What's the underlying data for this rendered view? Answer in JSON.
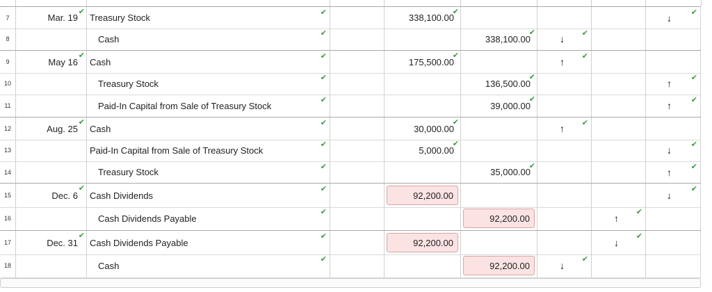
{
  "check_glyph": "✔",
  "arrow_up": "↑",
  "arrow_down": "↓",
  "colors": {
    "check": "#3d9a3d",
    "error_bg": "#fbe3e3",
    "error_border": "#d9a3a3"
  },
  "rows": [
    {
      "num": "7",
      "date": "Mar. 19",
      "account": "Treasury Stock",
      "indent": false,
      "debit": "338,100.00",
      "debit_check": true,
      "credit": "",
      "credit_check": false,
      "col1": "",
      "col2": "",
      "col3": "↓",
      "col3_check": true
    },
    {
      "num": "8",
      "date": "",
      "account": "Cash",
      "indent": true,
      "debit": "",
      "debit_check": false,
      "credit": "338,100.00",
      "credit_check": true,
      "col1": "↓",
      "col1_check": true,
      "col2": "",
      "col3": ""
    },
    {
      "num": "9",
      "date": "May 16",
      "account": "Cash",
      "indent": false,
      "debit": "175,500.00",
      "debit_check": true,
      "credit": "",
      "credit_check": false,
      "col1": "↑",
      "col1_check": true,
      "col2": "",
      "col3": ""
    },
    {
      "num": "10",
      "date": "",
      "account": "Treasury Stock",
      "indent": true,
      "debit": "",
      "debit_check": false,
      "credit": "136,500.00",
      "credit_check": true,
      "col1": "",
      "col2": "",
      "col3": "↑",
      "col3_check": true
    },
    {
      "num": "11",
      "date": "",
      "account": "Paid-In Capital from Sale of Treasury Stock",
      "indent": true,
      "debit": "",
      "debit_check": false,
      "credit": "39,000.00",
      "credit_check": true,
      "col1": "",
      "col2": "",
      "col3": "↑",
      "col3_check": true
    },
    {
      "num": "12",
      "date": "Aug. 25",
      "account": "Cash",
      "indent": false,
      "debit": "30,000.00",
      "debit_check": true,
      "credit": "",
      "credit_check": false,
      "col1": "↑",
      "col1_check": true,
      "col2": "",
      "col3": ""
    },
    {
      "num": "13",
      "date": "",
      "account": "Paid-In Capital from Sale of Treasury Stock",
      "indent": false,
      "debit": "5,000.00",
      "debit_check": true,
      "credit": "",
      "credit_check": false,
      "col1": "",
      "col2": "",
      "col3": "↓",
      "col3_check": true
    },
    {
      "num": "14",
      "date": "",
      "account": "Treasury Stock",
      "indent": true,
      "debit": "",
      "debit_check": false,
      "credit": "35,000.00",
      "credit_check": true,
      "col1": "",
      "col2": "",
      "col3": "↑",
      "col3_check": true
    },
    {
      "num": "15",
      "date": "Dec. 6",
      "account": "Cash Dividends",
      "indent": false,
      "debit": "92,200.00",
      "debit_error": true,
      "credit": "",
      "col1": "",
      "col2": "",
      "col3": "↓",
      "col3_check": true
    },
    {
      "num": "16",
      "date": "",
      "account": "Cash Dividends Payable",
      "indent": true,
      "debit": "",
      "credit": "92,200.00",
      "credit_error": true,
      "col1": "",
      "col2": "↑",
      "col2_check": true,
      "col3": ""
    },
    {
      "num": "17",
      "date": "Dec. 31",
      "account": "Cash Dividends Payable",
      "indent": false,
      "debit": "92,200.00",
      "debit_error": true,
      "credit": "",
      "col1": "",
      "col2": "↓",
      "col2_check": true,
      "col3": ""
    },
    {
      "num": "18",
      "date": "",
      "account": "Cash",
      "indent": true,
      "debit": "",
      "credit": "92,200.00",
      "credit_error": true,
      "col1": "↓",
      "col1_check": true,
      "col2": "",
      "col3": ""
    }
  ]
}
